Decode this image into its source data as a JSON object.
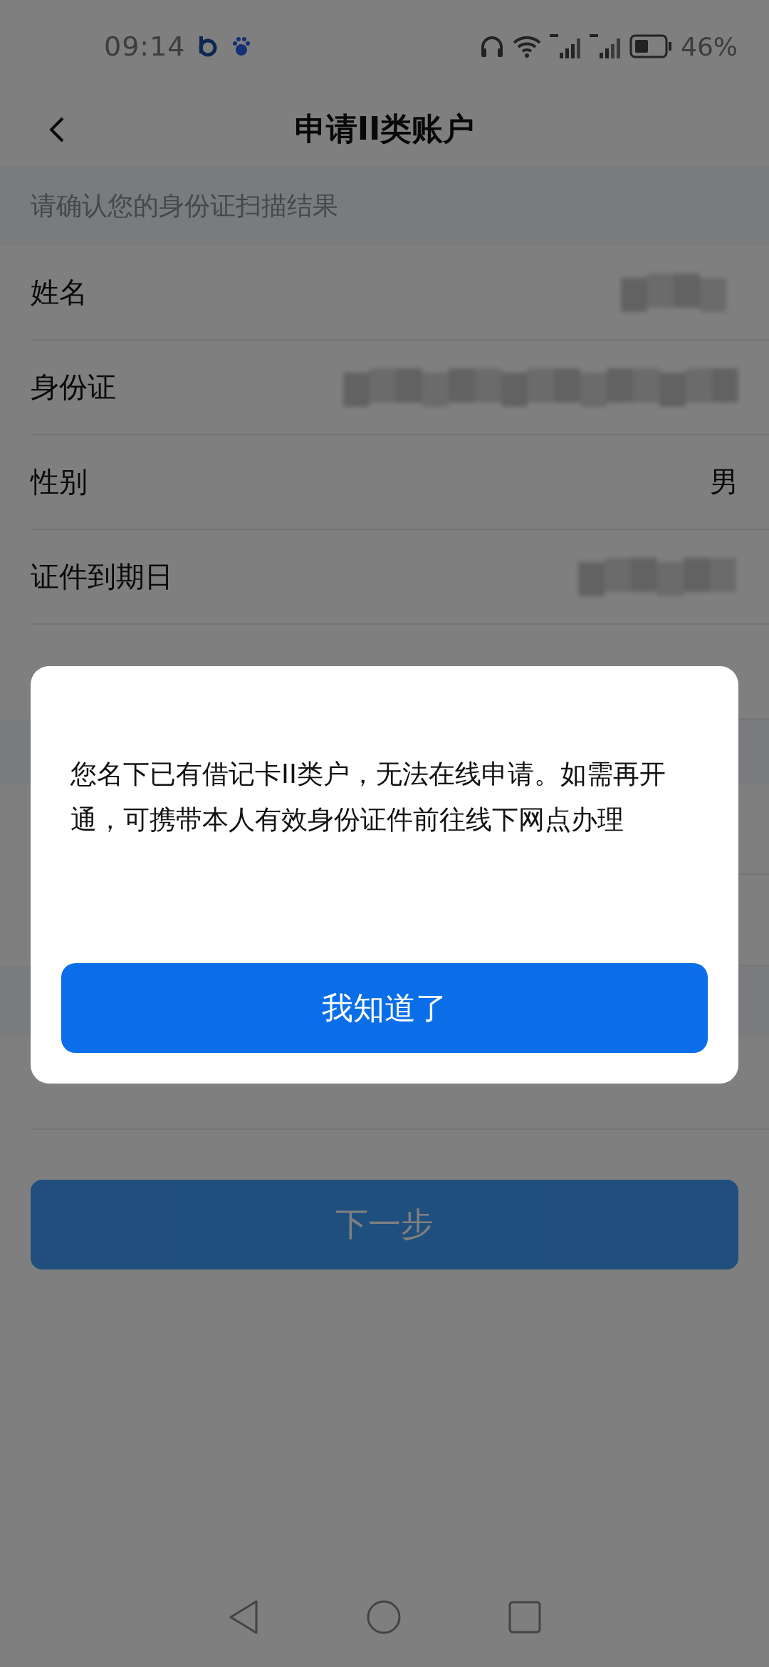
{
  "status_bar": {
    "time": "09:14",
    "battery": "46%"
  },
  "header": {
    "title": "申请II类账户"
  },
  "section_hint": "请确认您的身份证扫描结果",
  "fields": [
    {
      "label": "姓名",
      "kind": "masked"
    },
    {
      "label": "身份证",
      "kind": "masked"
    },
    {
      "label": "性别",
      "kind": "text",
      "value": "男"
    },
    {
      "label": "证件到期日",
      "kind": "masked"
    }
  ],
  "next_button": {
    "label": "下一步"
  },
  "dialog": {
    "message": "您名下已有借记卡II类户，无法在线申请。如需再开通，可携带本人有效身份证件前往线下网点办理",
    "button": "我知道了"
  }
}
